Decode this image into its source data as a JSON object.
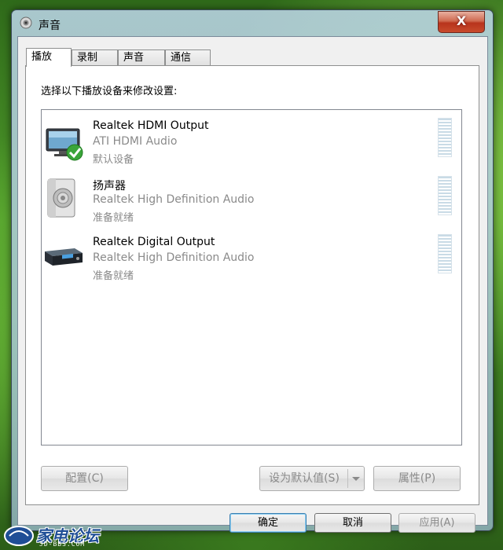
{
  "window": {
    "title": "声音",
    "close_label": "X"
  },
  "tabs": [
    {
      "label": "播放",
      "active": true
    },
    {
      "label": "录制",
      "active": false
    },
    {
      "label": "声音",
      "active": false
    },
    {
      "label": "通信",
      "active": false
    }
  ],
  "panel": {
    "instruction": "选择以下播放设备来修改设置:"
  },
  "devices": [
    {
      "name": "Realtek HDMI Output",
      "driver": "ATI HDMI Audio",
      "status": "默认设备",
      "icon": "monitor-icon",
      "is_default": true
    },
    {
      "name": "扬声器",
      "driver": "Realtek High Definition Audio",
      "status": "准备就绪",
      "icon": "speaker-icon",
      "is_default": false
    },
    {
      "name": "Realtek Digital Output",
      "driver": "Realtek High Definition Audio",
      "status": "准备就绪",
      "icon": "digital-receiver-icon",
      "is_default": false
    }
  ],
  "panel_buttons": {
    "configure": "配置(C)",
    "set_default": "设为默认值(S)",
    "properties": "属性(P)"
  },
  "dialog_buttons": {
    "ok": "确定",
    "cancel": "取消",
    "apply": "应用(A)"
  },
  "watermark": {
    "text": "家电论坛",
    "subtext": "JD-BBS.COM"
  },
  "colors": {
    "accent_check": "#3aa53a",
    "disabled_text": "#8a8a8a"
  }
}
